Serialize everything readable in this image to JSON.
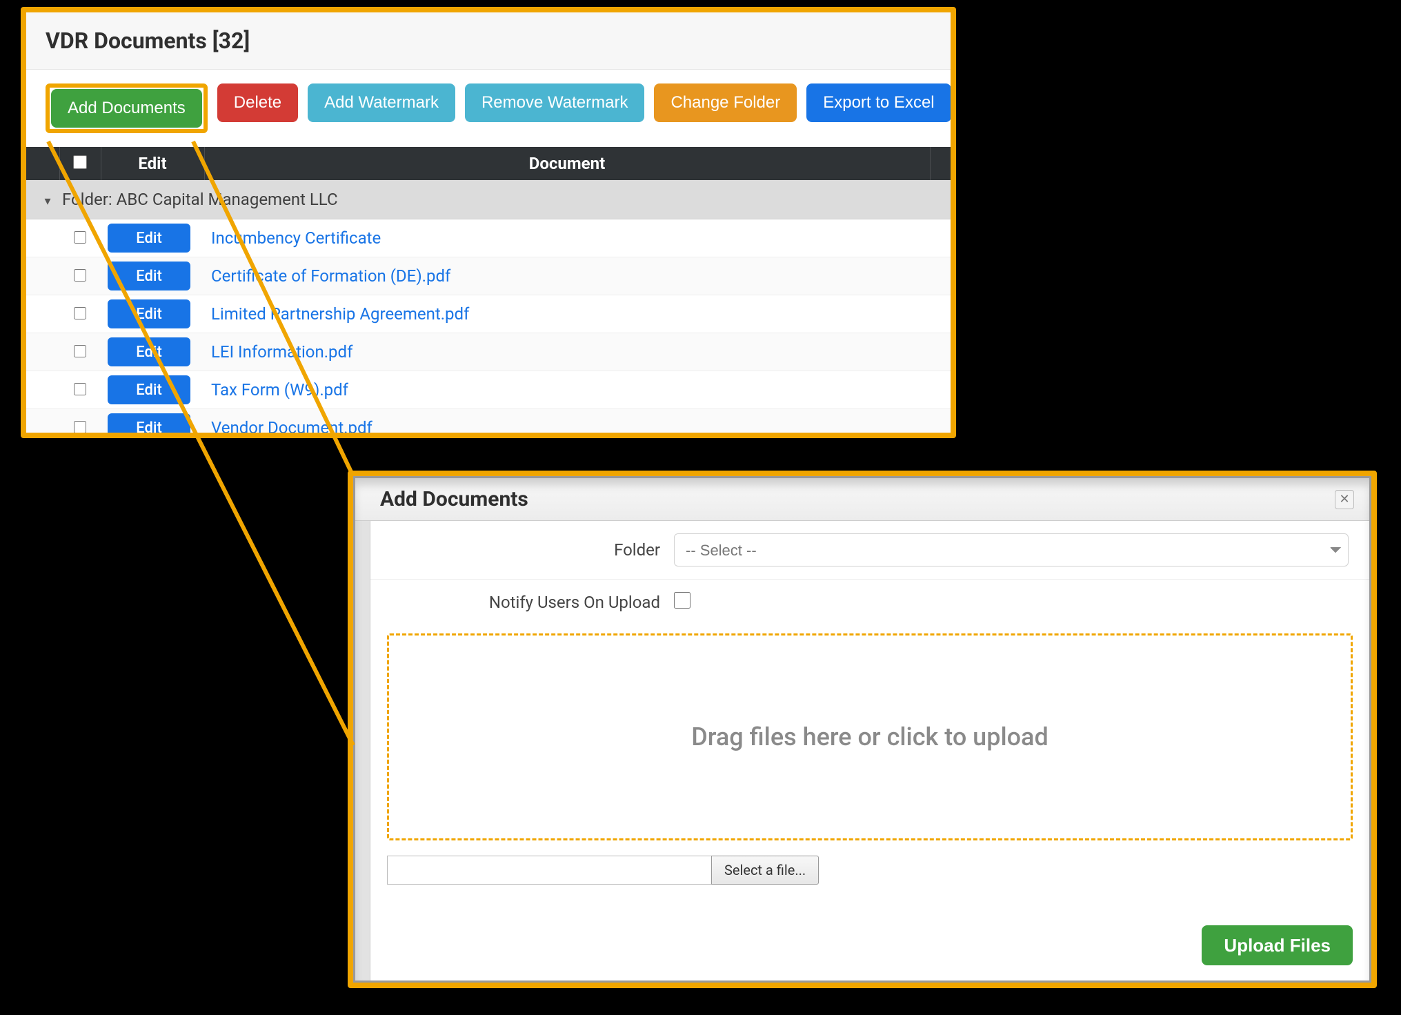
{
  "main": {
    "title": "VDR Documents [32]",
    "toolbar": {
      "add": "Add Documents",
      "delete": "Delete",
      "addWatermark": "Add Watermark",
      "removeWatermark": "Remove Watermark",
      "changeFolder": "Change Folder",
      "export": "Export to Excel"
    },
    "table": {
      "headers": {
        "edit": "Edit",
        "document": "Document"
      },
      "folderLabel": "Folder: ABC Capital Management LLC",
      "editLabel": "Edit",
      "docs": [
        "Incumbency Certificate",
        "Certificate of Formation (DE).pdf",
        "Limited Partnership Agreement.pdf",
        "LEI Information.pdf",
        "Tax Form (W9).pdf",
        "Vendor Document.pdf"
      ]
    }
  },
  "modal": {
    "title": "Add Documents",
    "form": {
      "folderLabel": "Folder",
      "folderSelected": "-- Select --",
      "notifyLabel": "Notify Users On Upload"
    },
    "dropText": "Drag files here or click to upload",
    "selectFile": "Select a file...",
    "upload": "Upload Files"
  }
}
